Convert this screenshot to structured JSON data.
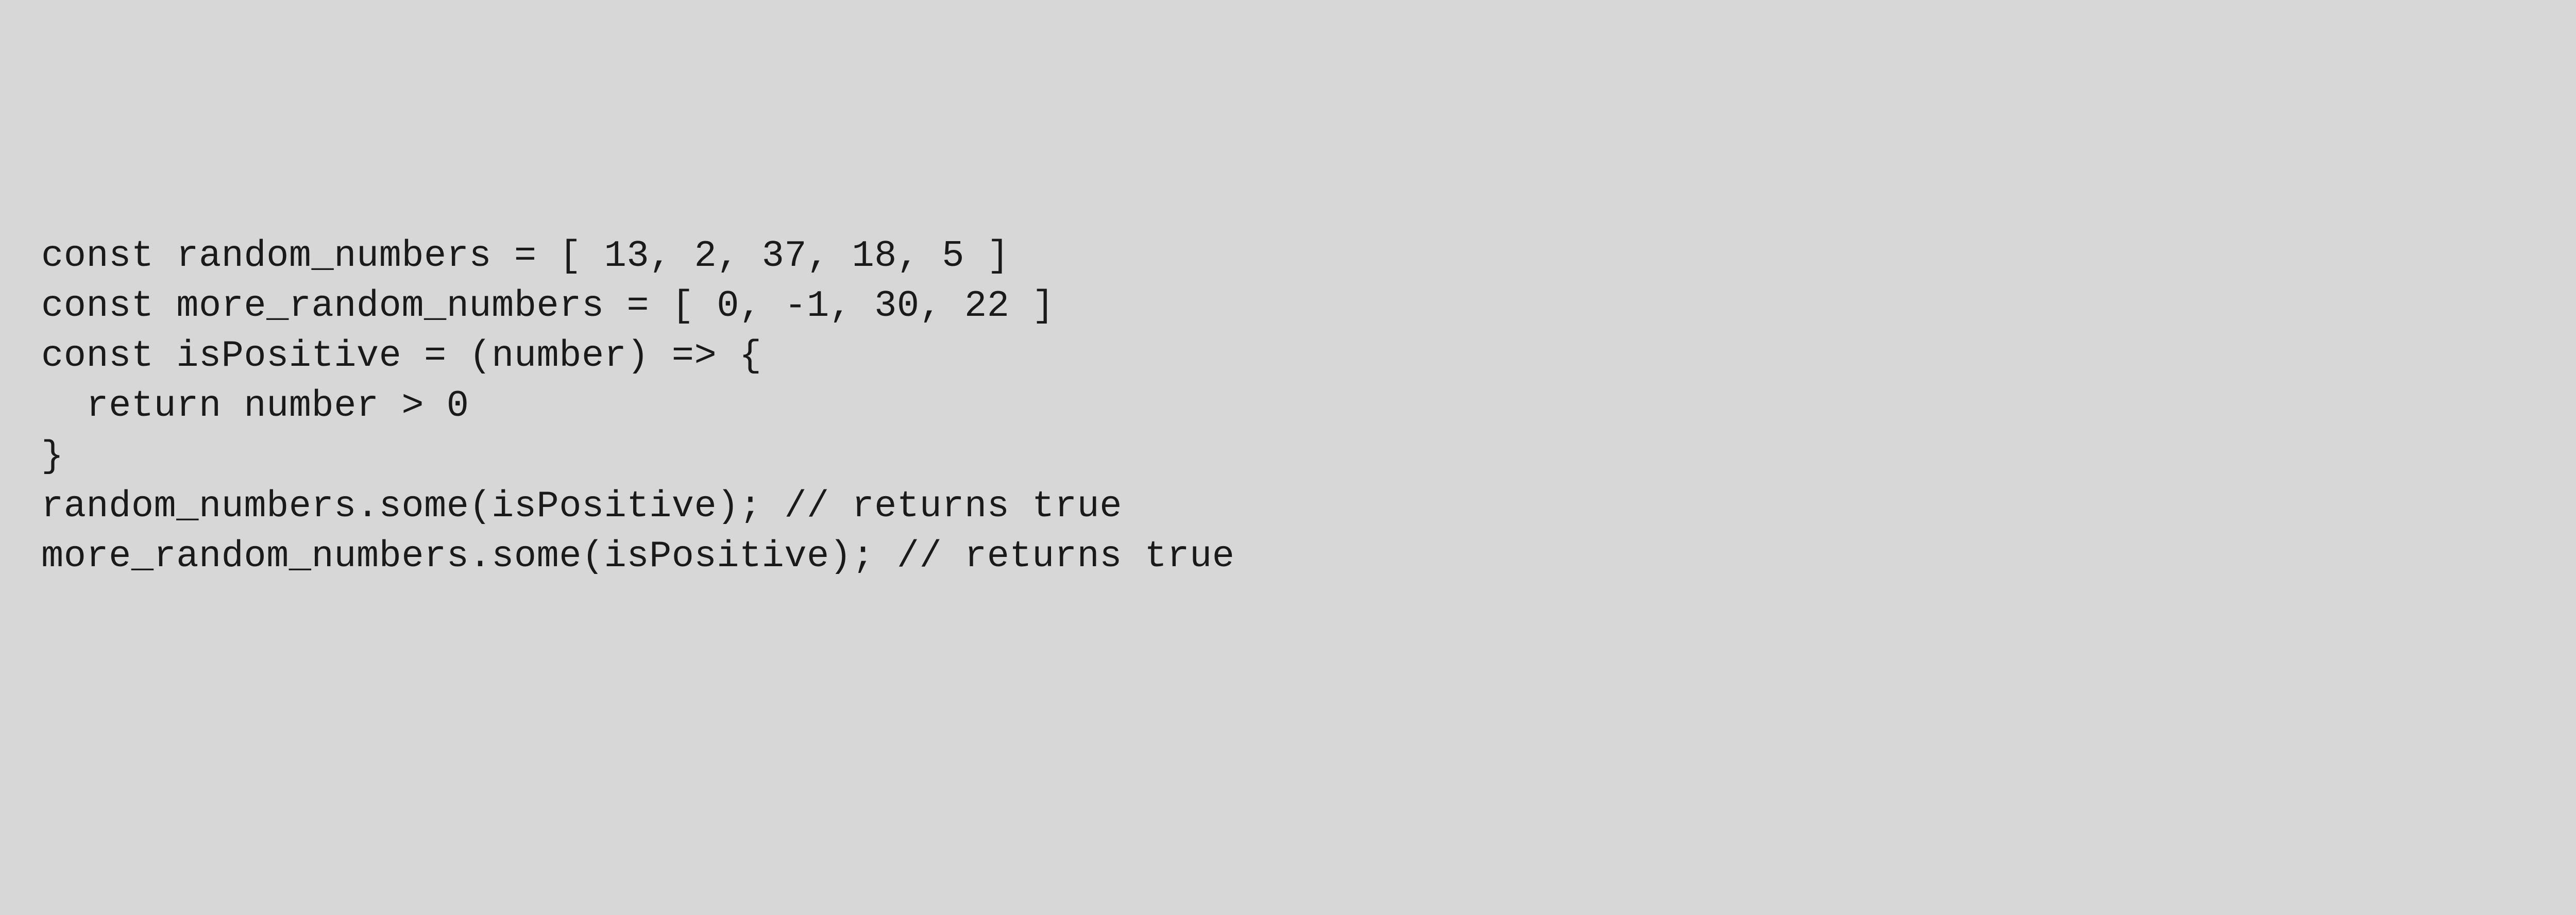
{
  "code": {
    "line1": "const random_numbers = [ 13, 2, 37, 18, 5 ]",
    "line2": "const more_random_numbers = [ 0, -1, 30, 22 ]",
    "line3": "const isPositive = (number) => {",
    "line4": "  return number > 0",
    "line5": "}",
    "line6": "random_numbers.some(isPositive); // returns true",
    "line7": "more_random_numbers.some(isPositive); // returns true"
  }
}
